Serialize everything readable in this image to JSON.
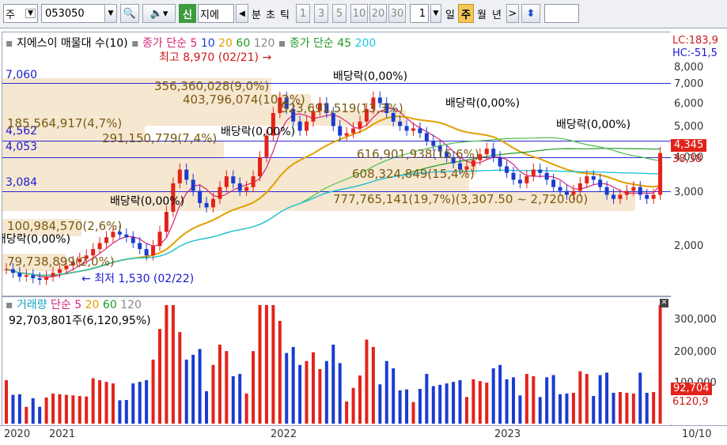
{
  "toolbar": {
    "period_select": "주",
    "code": "053050",
    "credit_badge": "신",
    "stock_name": "지에",
    "interval_items": [
      "분",
      "초",
      "틱",
      "1",
      "3",
      "5",
      "10",
      "20",
      "30"
    ],
    "count_value": "1",
    "period_items": [
      "일",
      "주",
      "월",
      "년"
    ],
    "selected_period": "주"
  },
  "price_chart": {
    "legend_title": "지에스이 매물대 수(10)",
    "legend_ma_label": "종가 단순",
    "legend_ma_periods": [
      "5",
      "10",
      "20",
      "60",
      "120"
    ],
    "legend_ma2_label": "종가 단순",
    "legend_ma2_periods": [
      "45",
      "200"
    ],
    "top_right_lc": "LC:183,9",
    "top_right_hc": "HC:-51,5",
    "high_marker": "최고 8,970 (02/21)",
    "low_marker": "최저 1,530 (02/22)",
    "hlines": [
      "7,060",
      "4,562",
      "4,053",
      "3,084"
    ],
    "volume_profile": [
      "356,360,028(9,0%)",
      "403,796,074(10,2%)",
      "523,691,519(13,3%)",
      "185,564,917(4,7%)",
      "291,150,779(7,4%)",
      "616,901,938(15,6%)",
      "608,324,849(15,4%)",
      "777,765,141(19,7%)(3,307.50 ~ 2,720.00)",
      "100,984,570(2,6%)",
      "79,738,899(2,0%)"
    ],
    "dividend_labels": [
      "배당락(0,00%)",
      "배당락(0,00%)",
      "배당락(0,00%)",
      "배당락(0,00%)",
      "배당락(0,00%)",
      "배당락(0,00%)"
    ],
    "y_ticks": [
      "8,000",
      "7,000",
      "6,000",
      "5,000",
      "4,000",
      "3,000",
      "2,000"
    ],
    "current_price": "4,345",
    "ma_value": "38,38"
  },
  "volume_chart": {
    "legend_label": "거래량",
    "legend_ma_label": "단순",
    "legend_ma_periods": [
      "5",
      "20",
      "60",
      "120"
    ],
    "summary": "92,703,801주(6,120,95%)",
    "y_ticks": [
      "300,000",
      "200,000",
      "100,000"
    ],
    "current_volume": "92,704",
    "current_ma": "6120,9"
  },
  "x_axis": {
    "labels": [
      "2020",
      "2021",
      "2022",
      "2023"
    ],
    "last_label": "10/10"
  },
  "chart_data": {
    "type": "candlestick",
    "weekly_close_approx": [
      1700,
      1650,
      1600,
      1620,
      1580,
      1560,
      1600,
      1650,
      1700,
      1750,
      1800,
      1850,
      1900,
      2000,
      2100,
      2200,
      2300,
      2250,
      2200,
      2100,
      2000,
      1900,
      2050,
      2300,
      2700,
      3400,
      3800,
      3500,
      3200,
      2900,
      2800,
      3000,
      3300,
      3600,
      3400,
      3200,
      3300,
      3600,
      4200,
      5000,
      6000,
      6800,
      6200,
      5600,
      5200,
      5600,
      6100,
      6500,
      6000,
      5400,
      5000,
      5100,
      5300,
      5600,
      6200,
      6800,
      6500,
      6000,
      5600,
      5400,
      5200,
      5300,
      5100,
      4800,
      4600,
      4400,
      4200,
      4000,
      3800,
      3900,
      4100,
      4300,
      4500,
      4200,
      3900,
      3700,
      3500,
      3400,
      3600,
      3800,
      3700,
      3500,
      3300,
      3200,
      3100,
      3200,
      3400,
      3600,
      3500,
      3300,
      3100,
      3000,
      3100,
      3200,
      3300,
      3100,
      3000,
      3100,
      4345
    ],
    "volume_profile_pct": [
      9.0,
      10.2,
      13.3,
      4.7,
      7.4,
      15.6,
      15.4,
      19.7,
      2.6,
      2.0
    ]
  }
}
